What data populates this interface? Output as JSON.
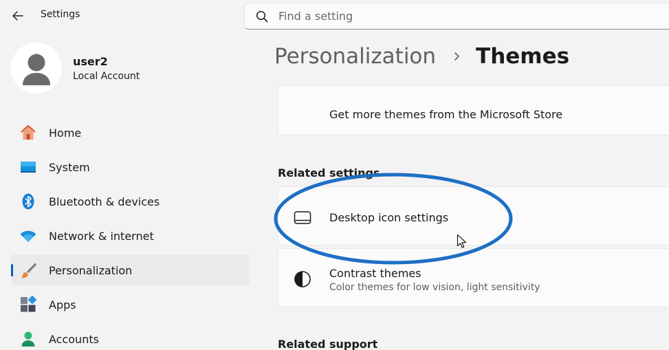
{
  "window": {
    "title": "Settings"
  },
  "search": {
    "placeholder": "Find a setting"
  },
  "user": {
    "name": "user2",
    "account_type": "Local Account"
  },
  "nav": {
    "items": [
      {
        "label": "Home",
        "icon": "home-icon"
      },
      {
        "label": "System",
        "icon": "system-icon"
      },
      {
        "label": "Bluetooth & devices",
        "icon": "bluetooth-icon"
      },
      {
        "label": "Network & internet",
        "icon": "wifi-icon"
      },
      {
        "label": "Personalization",
        "icon": "brush-icon",
        "active": true
      },
      {
        "label": "Apps",
        "icon": "apps-icon"
      },
      {
        "label": "Accounts",
        "icon": "accounts-icon"
      }
    ]
  },
  "breadcrumb": {
    "parent": "Personalization",
    "current": "Themes"
  },
  "store_card": {
    "title": "Get more themes from the Microsoft Store"
  },
  "related_settings": {
    "heading": "Related settings",
    "items": [
      {
        "title": "Desktop icon settings",
        "icon": "desktop-icon"
      },
      {
        "title": "Contrast themes",
        "subtitle": "Color themes for low vision, light sensitivity",
        "icon": "contrast-icon"
      }
    ]
  },
  "related_support": {
    "heading": "Related support"
  },
  "colors": {
    "accent": "#005fb8",
    "highlight_ellipse": "#1d6fc4",
    "background": "#f3f3f3",
    "card": "#fbfbfb"
  }
}
